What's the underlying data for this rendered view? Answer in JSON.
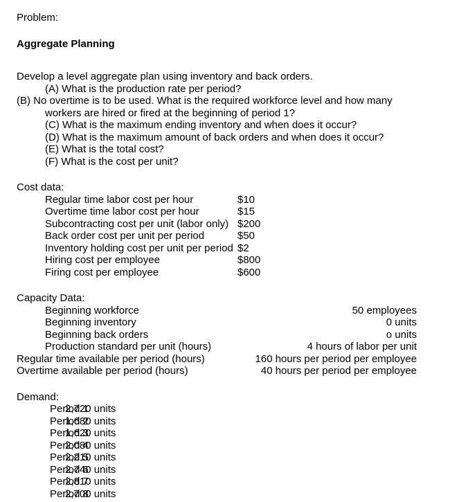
{
  "document": {
    "problem_label": "Problem:",
    "title": "Aggregate Planning",
    "intro": "Develop a level aggregate plan using inventory and back orders.",
    "questions": [
      "(A) What is the production rate per period?",
      "(B) No overtime is to be used. What is the required workforce level and how many workers are hired or fired at the beginning of period 1?",
      "(C) What is the maximum ending inventory and when does it occur?",
      "(D) What is the maximum amount of back orders and when does it occur?",
      "(E) What is the total cost?",
      "(F) What is the cost per unit?"
    ],
    "cost_data": {
      "heading": "Cost data:",
      "rows": [
        {
          "label": "Regular time labor cost per hour",
          "value": "$10"
        },
        {
          "label": "Overtime time labor cost per hour",
          "value": "$15"
        },
        {
          "label": "Subcontracting cost per unit (labor only)",
          "value": "$200"
        },
        {
          "label": "Back order cost per unit per period",
          "value": "$50"
        },
        {
          "label": "Inventory holding cost per unit per period",
          "value": "$2"
        },
        {
          "label": "Hiring cost per employee",
          "value": "$800"
        },
        {
          "label": "Firing cost per employee",
          "value": "$600"
        }
      ]
    },
    "capacity_data": {
      "heading": "Capacity Data:",
      "rows": [
        {
          "label": "Beginning workforce",
          "value": "50 employees",
          "indented": true
        },
        {
          "label": "Beginning inventory",
          "value": "0 units",
          "indented": true
        },
        {
          "label": "Beginning back orders",
          "value": "o units",
          "indented": true
        },
        {
          "label": "Production standard per unit (hours)",
          "value": "4 hours of labor per unit",
          "indented": true
        },
        {
          "label": "Regular time available per period (hours)",
          "value": "160 hours per period per employee",
          "indented": false
        },
        {
          "label": "Overtime available per period (hours)",
          "value": "40 hours per period per employee",
          "indented": false
        }
      ]
    },
    "demand": {
      "heading": "Demand:",
      "rows": [
        {
          "label": "Period 1",
          "value": "2,720 units"
        },
        {
          "label": "Period 2",
          "value": "1,680 units"
        },
        {
          "label": "Period 3",
          "value": "1,620 units"
        },
        {
          "label": "Period 4",
          "value": "2,080 units"
        },
        {
          "label": "Period 5",
          "value": "2,210 units"
        },
        {
          "label": "Period 6",
          "value": "2,740 units"
        },
        {
          "label": "Period 7",
          "value": "2,810 units"
        },
        {
          "label": "Period 8",
          "value": "2,700 units"
        }
      ]
    }
  }
}
